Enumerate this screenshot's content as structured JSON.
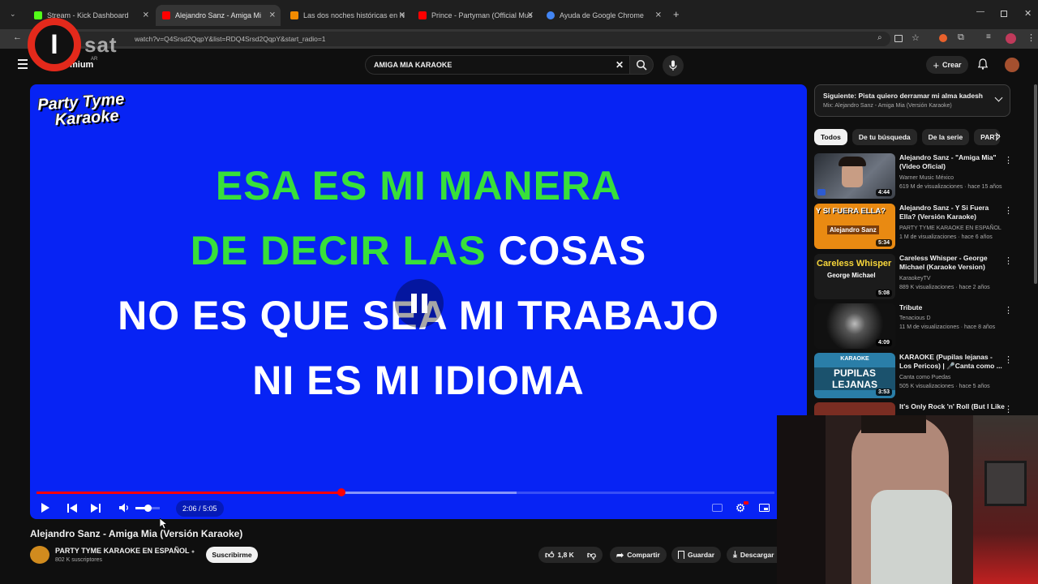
{
  "browser": {
    "tabs": [
      {
        "title": "Stream - Kick Dashboard",
        "color": "#53fc18"
      },
      {
        "title": "Alejandro Sanz - Amiga Mi",
        "color": "#ff0000"
      },
      {
        "title": "Las dos noches históricas en N",
        "color": "#f28b00"
      },
      {
        "title": "Prince - Partyman (Official Mus",
        "color": "#ff0000"
      },
      {
        "title": "Ayuda de Google Chrome",
        "color": "#4285f4"
      }
    ],
    "new_tab": "+",
    "url": "watch?v=Q4Srsd2QqpY&list=RDQ4Srsd2QqpY&start_radio=1"
  },
  "youtube": {
    "brand_suffix": "mium",
    "brand_region": "AR",
    "search_value": "AMIGA MIA KARAOKE",
    "create_label": "Crear"
  },
  "player": {
    "logo_line1": "Party Tyme",
    "logo_line2": "Karaoke",
    "lyrics": [
      {
        "sung": "ESA ES MI MANERA",
        "unsung": ""
      },
      {
        "sung": "DE DECIR LAS",
        "unsung": " COSAS"
      },
      {
        "sung": "",
        "unsung": "NO ES QUE SEA MI TRABAJO"
      },
      {
        "sung": "",
        "unsung": "NI ES MI IDIOMA"
      }
    ],
    "time": "2:06 / 5:05",
    "progress": 0.413,
    "buffered": 0.65,
    "volume": 0.5,
    "background": "#0723f4",
    "sung_color": "#38e03a"
  },
  "video": {
    "title": "Alejandro Sanz - Amiga Mia (Versión Karaoke)",
    "channel": "PARTY TYME KARAOKE EN ESPAÑOL",
    "subscribers": "802 K suscriptores",
    "subscribe_label": "Suscribirme",
    "likes": "1,8 K",
    "share_label": "Compartir",
    "save_label": "Guardar",
    "download_label": "Descargar"
  },
  "sidebar": {
    "next_label": "Siguiente: Pista quiero derramar mi alma kadesh",
    "next_sub": "Mix: Alejandro Sanz - Amiga Mia (Versión Karaoke)",
    "chips": [
      "Todos",
      "De tu búsqueda",
      "De la serie",
      "PARTY"
    ],
    "videos": [
      {
        "title": "Alejandro Sanz - \"Amiga Mia\" (Video Oficial)",
        "channel": "Warner Music México",
        "meta": "619 M de visualizaciones · hace 15 años",
        "duration": "4:44",
        "thumb": "#4a4f57"
      },
      {
        "title": "Alejandro Sanz - Y Si Fuera Ella? (Versión Karaoke)",
        "channel": "PARTY TYME KARAOKE EN ESPAÑOL",
        "meta": "1 M de visualizaciones · hace 6 años",
        "duration": "5:34",
        "thumb": "#e98a12",
        "thumb_text": "Y SI FUERA ELLA?",
        "thumb_sub": "Alejandro Sanz"
      },
      {
        "title": "Careless Whisper - George Michael (Karaoke Version)",
        "channel": "KaraokeyTV",
        "meta": "889 K visualizaciones · hace 2 años",
        "duration": "5:08",
        "thumb": "#1b1b1b",
        "thumb_text": "Careless Whisper",
        "thumb_sub": "George Michael"
      },
      {
        "title": "Tribute",
        "channel": "Tenacious D",
        "meta": "11 M de visualizaciones · hace 8 años",
        "duration": "4:09",
        "thumb": "#222"
      },
      {
        "title": "KARAOKE (Pupilas lejanas - Los Pericos) | 🎤Canta como ...",
        "channel": "Canta como Puedas",
        "meta": "505 K visualizaciones · hace 5 años",
        "duration": "3:53",
        "thumb": "#2a7ea8",
        "thumb_text": "PUPILAS LEJANAS",
        "thumb_sub": "KARAOKE"
      },
      {
        "title": "It's Only Rock 'n' Roll (But I Like",
        "channel": "",
        "meta": "",
        "duration": "",
        "thumb": "#7a2d22"
      }
    ]
  },
  "overlay": {
    "badge_letter": "I",
    "badge_text": "sat"
  }
}
